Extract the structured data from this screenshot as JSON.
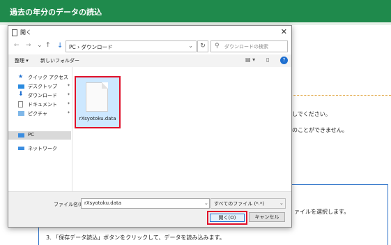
{
  "web": {
    "header_title": "過去の年分のデータの読込",
    "line1": "しでください。",
    "line2": "のことができません。",
    "step2_tail": "ァイルを選択します。",
    "step3": "3. 「保存データ読込」ボタンをクリックして、データを読み込みます。"
  },
  "dialog": {
    "title": "開く",
    "close": "✕",
    "nav": {
      "back": "←",
      "forward": "→",
      "up": "↑",
      "down_arrow": "↓",
      "path": "PC  ›  ダウンロード",
      "path_dropdown": "⌄",
      "refresh": "↻",
      "search_placeholder": "ダウンロードの検索"
    },
    "toolbar": {
      "organize": "整理 ▾",
      "new_folder": "新しいフォルダー",
      "view": "▤ ▾",
      "pane": "▯",
      "help": "?"
    },
    "sidebar": [
      {
        "label": "クイック アクセス",
        "icon": "star-icon"
      },
      {
        "label": "デスクトップ",
        "icon": "desktop-icon",
        "pin": "✦"
      },
      {
        "label": "ダウンロード",
        "icon": "download-icon",
        "pin": "✦"
      },
      {
        "label": "ドキュメント",
        "icon": "document-icon",
        "pin": "✦"
      },
      {
        "label": "ピクチャ",
        "icon": "picture-icon",
        "pin": "✦"
      },
      {
        "label": "PC",
        "icon": "pc-icon"
      },
      {
        "label": "ネットワーク",
        "icon": "network-icon"
      }
    ],
    "file": {
      "name": "rXsyotoku.data"
    },
    "bottom": {
      "file_name_label": "ファイル名(N):",
      "file_name_value": "rXsyotoku.data",
      "file_type": "すべてのファイル (*.*)",
      "open": "開く(O)",
      "cancel": "キャンセル"
    }
  },
  "colors": {
    "header_green": "#1f8a4c",
    "highlight_red": "#e0102a",
    "selection_blue": "#cde8ff",
    "accent_blue": "#1e6fd0"
  }
}
